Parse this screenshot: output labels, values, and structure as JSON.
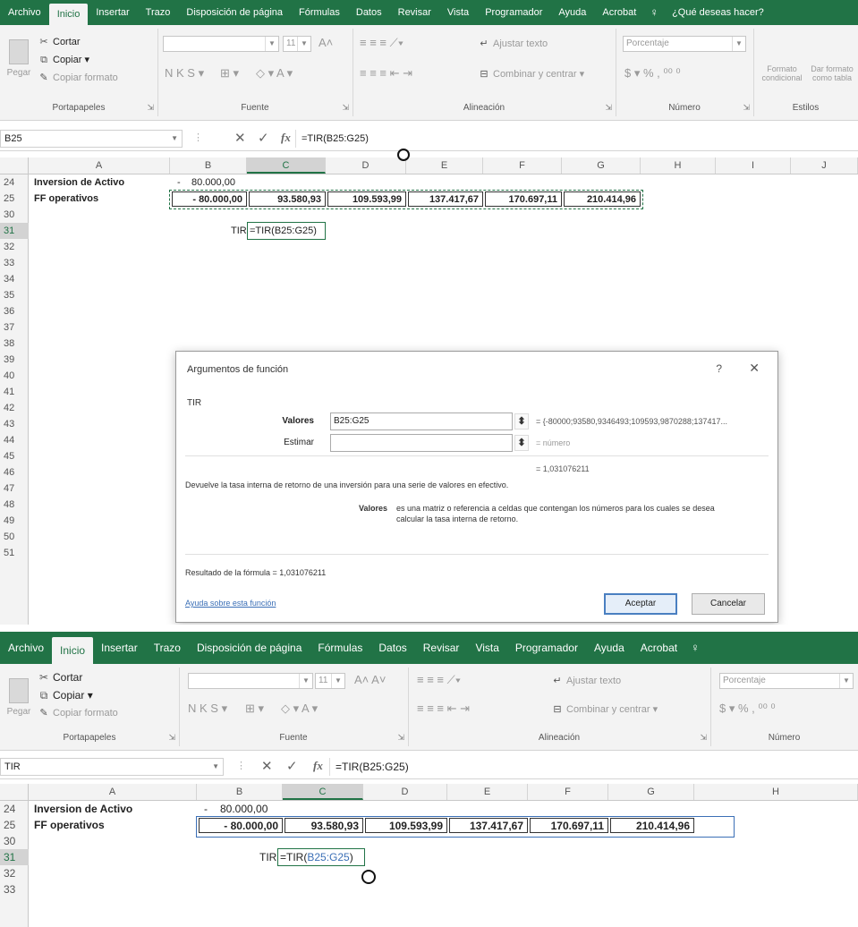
{
  "ribbon": {
    "tabs": [
      "Archivo",
      "Inicio",
      "Insertar",
      "Trazo",
      "Disposición de página",
      "Fórmulas",
      "Datos",
      "Revisar",
      "Vista",
      "Programador",
      "Ayuda",
      "Acrobat"
    ],
    "active_tab": "Inicio",
    "tell_me": "¿Qué deseas hacer?",
    "clipboard": {
      "paste": "Pegar",
      "cut": "Cortar",
      "copy": "Copiar",
      "format_painter": "Copiar formato",
      "label": "Portapapeles"
    },
    "font": {
      "label": "Fuente",
      "font_size": "11"
    },
    "alignment": {
      "wrap": "Ajustar texto",
      "merge": "Combinar y centrar",
      "label": "Alineación"
    },
    "number": {
      "format": "Porcentaje",
      "label": "Número"
    },
    "styles": {
      "conditional": "Formato condicional",
      "table": "Dar formato como tabla",
      "label": "Estilos"
    }
  },
  "screen1": {
    "name_box": "B25",
    "formula": "=TIR(B25:G25)",
    "columns": [
      "A",
      "B",
      "C",
      "D",
      "E",
      "F",
      "G",
      "H",
      "I",
      "J"
    ],
    "rows": [
      "24",
      "25",
      "30",
      "31",
      "32",
      "33",
      "34",
      "35",
      "36",
      "37",
      "38",
      "39",
      "40",
      "41",
      "42",
      "43",
      "44",
      "45",
      "46",
      "47",
      "48",
      "49",
      "50",
      "51"
    ]
  },
  "screen2": {
    "name_box": "TIR",
    "formula": "=TIR(B25:G25)",
    "columns": [
      "A",
      "B",
      "C",
      "D",
      "E",
      "F",
      "G",
      "H"
    ],
    "rows": [
      "24",
      "25",
      "30",
      "31",
      "32",
      "33"
    ]
  },
  "sheet": {
    "a24": "Inversion de Activo",
    "a25": "FF operativos",
    "b24_sign": "-",
    "b24": "80.000,00",
    "row25": [
      "-  80.000,00",
      "93.580,93",
      "109.593,99",
      "137.417,67",
      "170.697,11",
      "210.414,96"
    ],
    "tir_label": "TIR",
    "tir_formula_fn": "=TIR(",
    "tir_formula_ref": "B25:G25",
    "tir_formula_end": ")"
  },
  "dialog": {
    "title": "Argumentos de función",
    "help": "?",
    "function_name": "TIR",
    "arg1_label": "Valores",
    "arg1_value": "B25:G25",
    "arg1_result": "= {-80000;93580,9346493;109593,9870288;137417...",
    "arg2_label": "Estimar",
    "arg2_value": "",
    "arg2_result": "= número",
    "overall_result": "= 1,031076211",
    "description": "Devuelve la tasa interna de retorno de una inversión para una serie de valores en efectivo.",
    "param_name": "Valores",
    "param_desc_line1": "es una matriz o referencia a celdas que contengan los números para los cuales se desea",
    "param_desc_line2": "calcular la tasa interna de retorno.",
    "formula_result": "Resultado de la fórmula =   1,031076211",
    "help_link": "Ayuda sobre esta función",
    "ok": "Aceptar",
    "cancel": "Cancelar"
  }
}
